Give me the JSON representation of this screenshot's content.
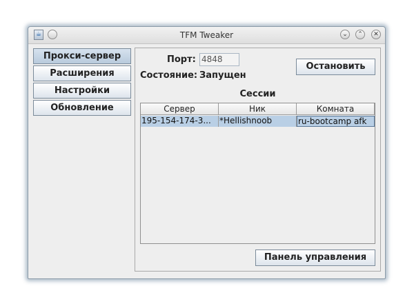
{
  "window": {
    "title": "TFM Tweaker",
    "icon": "java-cup-icon",
    "controls": [
      "minimize-icon",
      "maximize-icon",
      "close-icon"
    ]
  },
  "sidebar": {
    "items": [
      {
        "label": "Прокси-сервер",
        "active": true
      },
      {
        "label": "Расширения",
        "active": false
      },
      {
        "label": "Настройки",
        "active": false
      },
      {
        "label": "Обновление",
        "active": false
      }
    ]
  },
  "proxy": {
    "port_label": "Порт:",
    "port_value": "4848",
    "state_label": "Состояние:",
    "state_value": "Запущен",
    "stop_button": "Остановить",
    "sessions_title": "Сессии",
    "control_panel_button": "Панель управления"
  },
  "table": {
    "columns": [
      "Сервер",
      "Ник",
      "Комната"
    ],
    "rows": [
      [
        "195-154-174-3...",
        "*Hellishnoob",
        "ru-bootcamp afk"
      ]
    ]
  },
  "colors": {
    "selection": "#b9cfe5",
    "button_border": "#7a8a99"
  }
}
